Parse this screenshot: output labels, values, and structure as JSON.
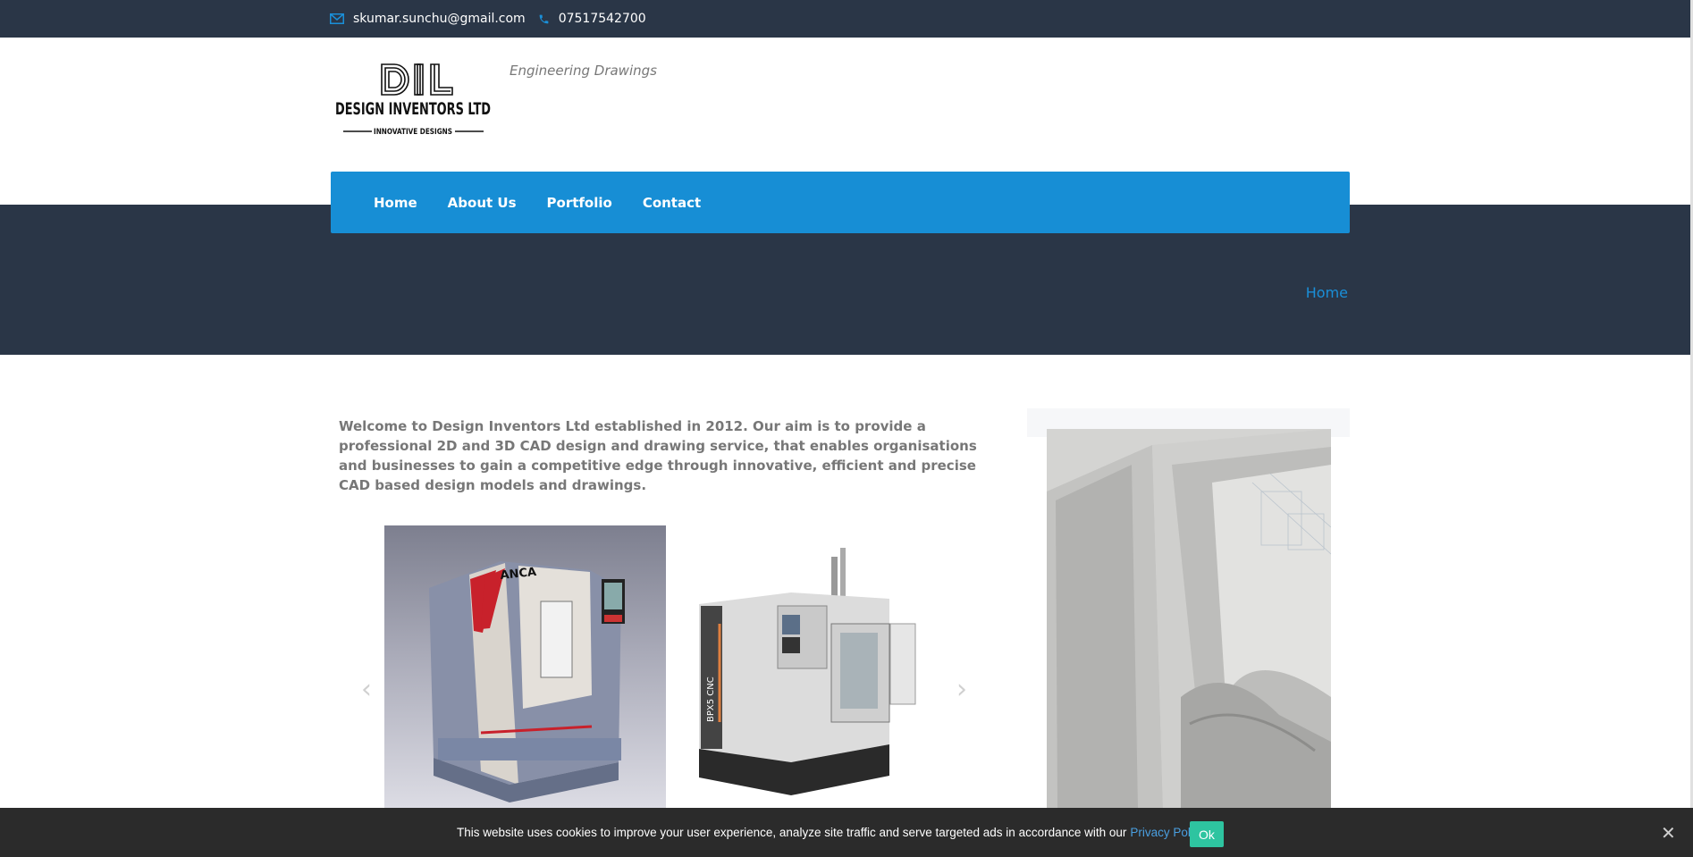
{
  "topbar": {
    "email": "skumar.sunchu@gmail.com",
    "phone": "07517542700",
    "email_icon": "mail-icon",
    "phone_icon": "phone-icon"
  },
  "header": {
    "logo": {
      "monogram": "DIL",
      "company": "DESIGN INVENTORS LTD",
      "slogan": "INNOVATIVE DESIGNS"
    },
    "tagline": "Engineering Drawings"
  },
  "nav": {
    "items": [
      {
        "label": "Home"
      },
      {
        "label": "About Us"
      },
      {
        "label": "Portfolio"
      },
      {
        "label": "Contact"
      }
    ]
  },
  "breadcrumb": {
    "current": "Home"
  },
  "main": {
    "intro": "Welcome to Design Inventors Ltd established in 2012. Our aim is to provide a professional 2D and 3D CAD design and drawing service, that enables organisations and businesses to gain a competitive edge through innovative, efficient and precise CAD based design models and drawings.",
    "slides": [
      {
        "brand": "ANCA"
      },
      {
        "brand": "BPX5 CNC"
      }
    ]
  },
  "cookie": {
    "text": "This website uses cookies to improve your user experience, analyze site traffic and serve targeted ads in accordance with our",
    "policy_link": "Privacy Policy.",
    "ok_label": "Ok",
    "close_glyph": "✕"
  },
  "colors": {
    "dark": "#2a3647",
    "accent": "#178ed5",
    "ok": "#2ec4a0"
  }
}
